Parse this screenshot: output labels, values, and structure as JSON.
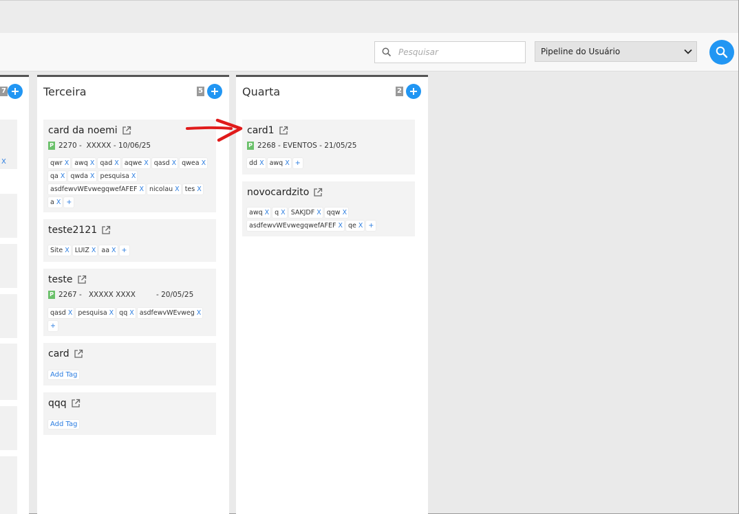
{
  "toolbar": {
    "search_placeholder": "Pesquisar",
    "pipeline_selected": "Pipeline do Usuário"
  },
  "left_column": {
    "count": "7",
    "partial_tag_x": "X"
  },
  "columns": [
    {
      "title": "Terceira",
      "count": "5",
      "cards": [
        {
          "title": "card da noemi",
          "badge": "P",
          "meta": "2270 -  XXXXX - 10/06/25",
          "tags": [
            "qwr",
            "awq",
            "qad",
            "aqwe",
            "qasd",
            "qwea",
            "qa",
            "qwda",
            "pesquisa",
            "asdfewvWEvwegqwefAFEF",
            "nicolau",
            "tes",
            "a"
          ],
          "add": "+"
        },
        {
          "title": "teste2121",
          "tags": [
            "Site",
            "LUIZ",
            "aa"
          ],
          "add": "+"
        },
        {
          "title": "teste",
          "badge": "P",
          "meta": "2267 -   XXXXX XXXX         - 20/05/25",
          "tags": [
            "qasd",
            "pesquisa",
            "qq",
            "asdfewvWEvweg"
          ],
          "add": "+"
        },
        {
          "title": "card",
          "add_tag": "Add Tag"
        },
        {
          "title": "qqq",
          "add_tag": "Add Tag"
        }
      ]
    },
    {
      "title": "Quarta",
      "count": "2",
      "cards": [
        {
          "title": "card1",
          "badge": "P",
          "meta": "2268 - EVENTOS - 21/05/25",
          "tags": [
            "dd",
            "awq"
          ],
          "add": "+"
        },
        {
          "title": "novocardzito",
          "tags": [
            "awq",
            "q",
            "SAKJDF",
            "qqw",
            "asdfewvWEvwegqwefAFEF",
            "qe"
          ],
          "add": "+"
        }
      ]
    }
  ],
  "tag_remove_label": "X",
  "colors": {
    "accent": "#2196f3",
    "badge_green": "#6ac06a",
    "annotation_arrow": "#e01b1b"
  }
}
